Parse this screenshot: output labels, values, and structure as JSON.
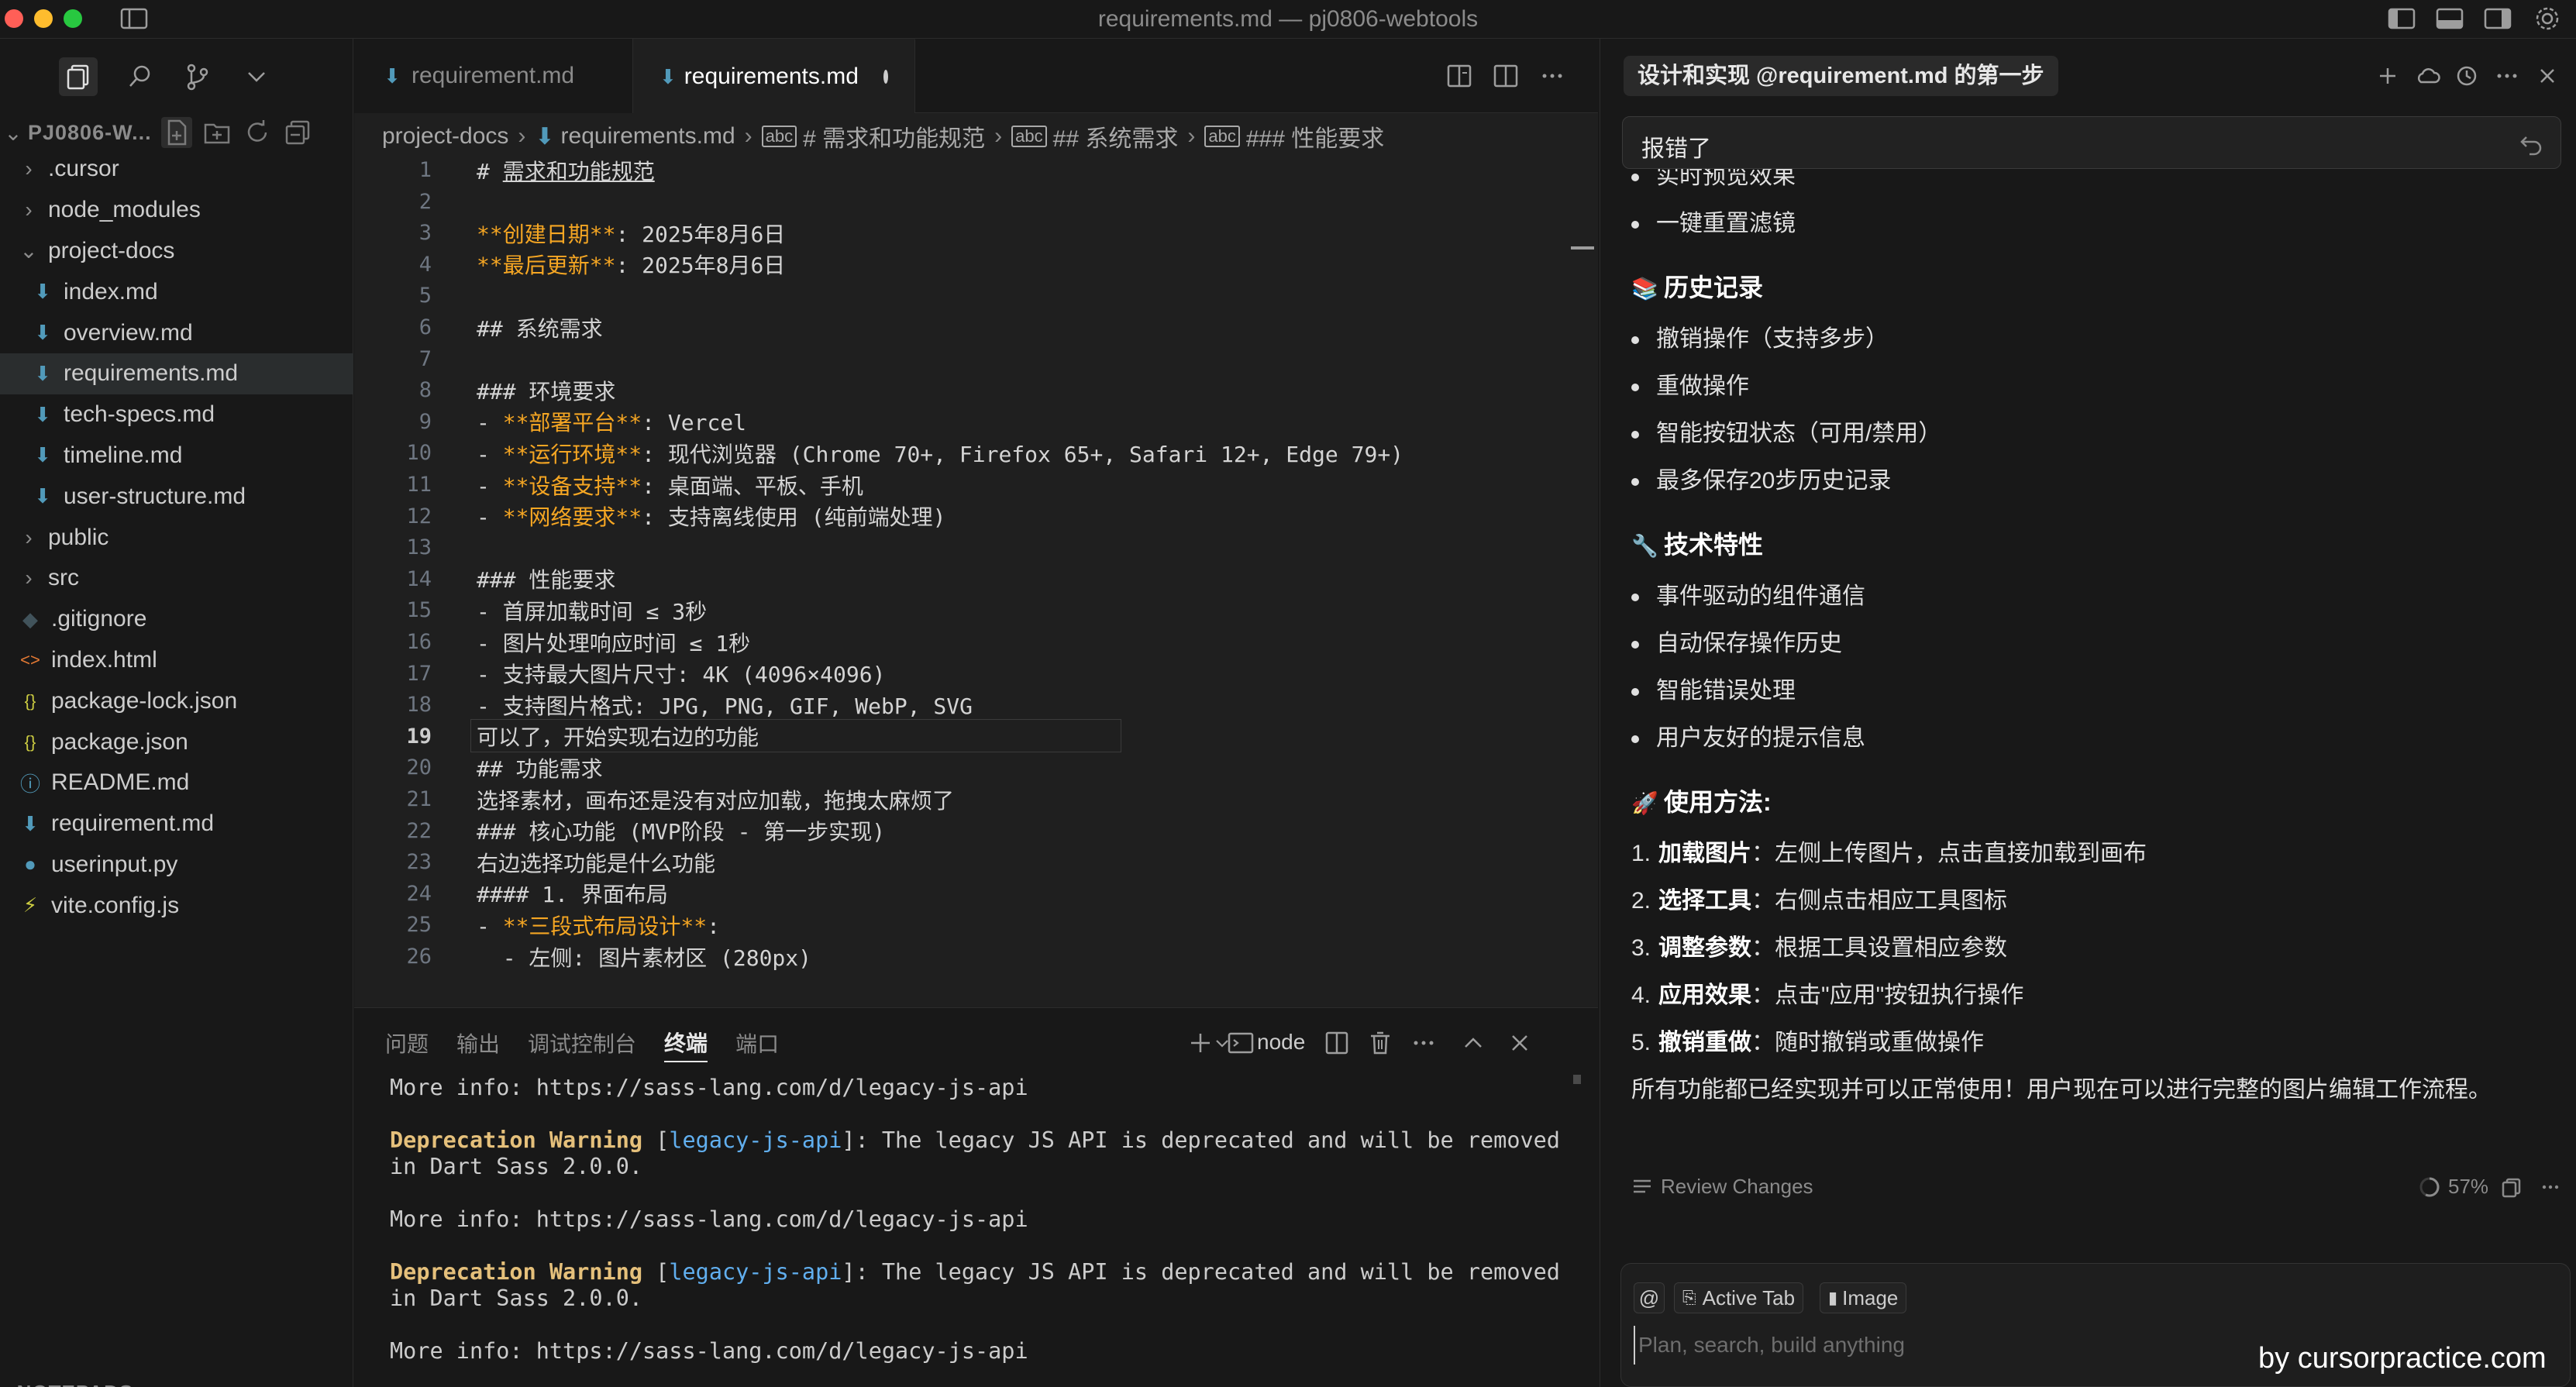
{
  "window": {
    "title": "requirements.md — pj0806-webtools"
  },
  "sidebar": {
    "root_label": "PJ0806-W...",
    "footer_label": "NOTEPADS",
    "tree": [
      {
        "label": ".cursor",
        "kind": "folder",
        "depth": 0,
        "expanded": false
      },
      {
        "label": "node_modules",
        "kind": "folder",
        "depth": 0,
        "expanded": false
      },
      {
        "label": "project-docs",
        "kind": "folder",
        "depth": 0,
        "expanded": true
      },
      {
        "label": "index.md",
        "kind": "md",
        "depth": 1
      },
      {
        "label": "overview.md",
        "kind": "md",
        "depth": 1
      },
      {
        "label": "requirements.md",
        "kind": "md",
        "depth": 1,
        "selected": true
      },
      {
        "label": "tech-specs.md",
        "kind": "md",
        "depth": 1
      },
      {
        "label": "timeline.md",
        "kind": "md",
        "depth": 1
      },
      {
        "label": "user-structure.md",
        "kind": "md",
        "depth": 1
      },
      {
        "label": "public",
        "kind": "folder",
        "depth": 0,
        "expanded": false
      },
      {
        "label": "src",
        "kind": "folder",
        "depth": 0,
        "expanded": false
      },
      {
        "label": ".gitignore",
        "kind": "git",
        "depth": 0
      },
      {
        "label": "index.html",
        "kind": "html",
        "depth": 0
      },
      {
        "label": "package-lock.json",
        "kind": "json",
        "depth": 0
      },
      {
        "label": "package.json",
        "kind": "json",
        "depth": 0
      },
      {
        "label": "README.md",
        "kind": "info",
        "depth": 0
      },
      {
        "label": "requirement.md",
        "kind": "md",
        "depth": 0
      },
      {
        "label": "userinput.py",
        "kind": "py",
        "depth": 0
      },
      {
        "label": "vite.config.js",
        "kind": "js",
        "depth": 0
      }
    ]
  },
  "editor": {
    "tabs": [
      {
        "label": "requirement.md",
        "active": false
      },
      {
        "label": "requirements.md",
        "active": true,
        "dirty": true
      }
    ],
    "breadcrumb": {
      "folder": "project-docs",
      "file": "requirements.md",
      "s1": "# 需求和功能规范",
      "s2": "## 系统需求",
      "s3": "### 性能要求"
    },
    "current_line": 19,
    "lines": [
      {
        "n": "1",
        "parts": [
          {
            "t": "# "
          },
          {
            "t": "需求和功能规范",
            "u": true
          }
        ]
      },
      {
        "n": "2",
        "parts": []
      },
      {
        "n": "3",
        "parts": [
          {
            "t": "**创建日期**",
            "b": true
          },
          {
            "t": ": 2025年8月6日"
          }
        ]
      },
      {
        "n": "4",
        "parts": [
          {
            "t": "**最后更新**",
            "b": true
          },
          {
            "t": ": 2025年8月6日"
          }
        ]
      },
      {
        "n": "5",
        "parts": []
      },
      {
        "n": "6",
        "parts": [
          {
            "t": "## 系统需求"
          }
        ]
      },
      {
        "n": "7",
        "parts": []
      },
      {
        "n": "8",
        "parts": [
          {
            "t": "### 环境要求"
          }
        ]
      },
      {
        "n": "9",
        "parts": [
          {
            "t": "- "
          },
          {
            "t": "**部署平台**",
            "b": true
          },
          {
            "t": ": Vercel"
          }
        ]
      },
      {
        "n": "10",
        "parts": [
          {
            "t": "- "
          },
          {
            "t": "**运行环境**",
            "b": true
          },
          {
            "t": ": 现代浏览器 (Chrome 70+, Firefox 65+, Safari 12+, Edge 79+)"
          }
        ]
      },
      {
        "n": "11",
        "parts": [
          {
            "t": "- "
          },
          {
            "t": "**设备支持**",
            "b": true
          },
          {
            "t": ": 桌面端、平板、手机"
          }
        ]
      },
      {
        "n": "12",
        "parts": [
          {
            "t": "- "
          },
          {
            "t": "**网络要求**",
            "b": true
          },
          {
            "t": ": 支持离线使用 (纯前端处理)"
          }
        ]
      },
      {
        "n": "13",
        "parts": []
      },
      {
        "n": "14",
        "parts": [
          {
            "t": "### 性能要求"
          }
        ]
      },
      {
        "n": "15",
        "parts": [
          {
            "t": "- 首屏加载时间 ≤ 3秒"
          }
        ]
      },
      {
        "n": "16",
        "parts": [
          {
            "t": "- 图片处理响应时间 ≤ 1秒"
          }
        ]
      },
      {
        "n": "17",
        "parts": [
          {
            "t": "- 支持最大图片尺寸: 4K (4096×4096)"
          }
        ]
      },
      {
        "n": "18",
        "parts": [
          {
            "t": "- 支持图片格式: JPG, PNG, GIF, WebP, SVG"
          }
        ]
      },
      {
        "n": "19",
        "parts": [
          {
            "t": "可以了，开始实现右边的功能"
          }
        ]
      },
      {
        "n": "20",
        "parts": [
          {
            "t": "## 功能需求"
          }
        ]
      },
      {
        "n": "21",
        "parts": [
          {
            "t": "选择素材，画布还是没有对应加载，拖拽太麻烦了"
          }
        ]
      },
      {
        "n": "22",
        "parts": [
          {
            "t": "### 核心功能 (MVP阶段 - 第一步实现)"
          }
        ]
      },
      {
        "n": "23",
        "parts": [
          {
            "t": "右边选择功能是什么功能"
          }
        ]
      },
      {
        "n": "24",
        "parts": [
          {
            "t": "#### 1. 界面布局"
          }
        ]
      },
      {
        "n": "25",
        "parts": [
          {
            "t": "- "
          },
          {
            "t": "**三段式布局设计**",
            "b": true
          },
          {
            "t": ":"
          }
        ]
      },
      {
        "n": "26",
        "parts": [
          {
            "t": "  - 左侧: 图片素材区 (280px)"
          }
        ]
      }
    ]
  },
  "panel": {
    "tabs": [
      "问题",
      "输出",
      "调试控制台",
      "终端",
      "端口"
    ],
    "active_tab": "终端",
    "terminal_name": "node",
    "terminal_lines": [
      {
        "type": "plain",
        "text": "More info: https://sass-lang.com/d/legacy-js-api"
      },
      {
        "type": "blank",
        "text": ""
      },
      {
        "type": "warn",
        "warn": "Deprecation Warning",
        "pre": " [",
        "link": "legacy-js-api",
        "post": "]: The legacy JS API is deprecated and will be removed"
      },
      {
        "type": "plain",
        "text": "in Dart Sass 2.0.0."
      },
      {
        "type": "blank",
        "text": ""
      },
      {
        "type": "plain",
        "text": "More info: https://sass-lang.com/d/legacy-js-api"
      },
      {
        "type": "blank",
        "text": ""
      },
      {
        "type": "warn",
        "warn": "Deprecation Warning",
        "pre": " [",
        "link": "legacy-js-api",
        "post": "]: The legacy JS API is deprecated and will be removed"
      },
      {
        "type": "plain",
        "text": "in Dart Sass 2.0.0."
      },
      {
        "type": "blank",
        "text": ""
      },
      {
        "type": "plain",
        "text": "More info: https://sass-lang.com/d/legacy-js-api"
      }
    ]
  },
  "chat": {
    "title": "设计和实现 @requirement.md 的第一步",
    "user_message": "报错了",
    "content": [
      {
        "kind": "bullet",
        "text": "实时预览效果"
      },
      {
        "kind": "bullet",
        "text": "一键重置滤镜"
      },
      {
        "kind": "heading",
        "emoji": "📚",
        "text": "历史记录"
      },
      {
        "kind": "bullet",
        "text": "撤销操作（支持多步）"
      },
      {
        "kind": "bullet",
        "text": "重做操作"
      },
      {
        "kind": "bullet",
        "text": "智能按钮状态（可用/禁用）"
      },
      {
        "kind": "bullet",
        "text": "最多保存20步历史记录"
      },
      {
        "kind": "heading",
        "emoji": "🔧",
        "text": "技术特性"
      },
      {
        "kind": "bullet",
        "text": "事件驱动的组件通信"
      },
      {
        "kind": "bullet",
        "text": "自动保存操作历史"
      },
      {
        "kind": "bullet",
        "text": "智能错误处理"
      },
      {
        "kind": "bullet",
        "text": "用户友好的提示信息"
      },
      {
        "kind": "heading",
        "emoji": "🚀",
        "text": "使用方法:"
      },
      {
        "kind": "numbered",
        "num": "1.",
        "bold": "加载图片",
        "text": "：左侧上传图片，点击直接加载到画布"
      },
      {
        "kind": "numbered",
        "num": "2.",
        "bold": "选择工具",
        "text": "：右侧点击相应工具图标"
      },
      {
        "kind": "numbered",
        "num": "3.",
        "bold": "调整参数",
        "text": "：根据工具设置相应参数"
      },
      {
        "kind": "numbered",
        "num": "4.",
        "bold": "应用效果",
        "text": "：点击\"应用\"按钮执行操作"
      },
      {
        "kind": "numbered",
        "num": "5.",
        "bold": "撤销重做",
        "text": "：随时撤销或重做操作"
      },
      {
        "kind": "para",
        "text": "所有功能都已经实现并可以正常使用！用户现在可以进行完整的图片编辑工作流程。"
      }
    ],
    "review_label": "Review Changes",
    "progress_text": "57%",
    "progress_value": 0.57,
    "composer": {
      "at_label": "@",
      "chip_tab": "Active Tab",
      "chip_image": "Image",
      "placeholder": "Plan, search, build anything"
    }
  },
  "watermark": "by cursorpractice.com"
}
